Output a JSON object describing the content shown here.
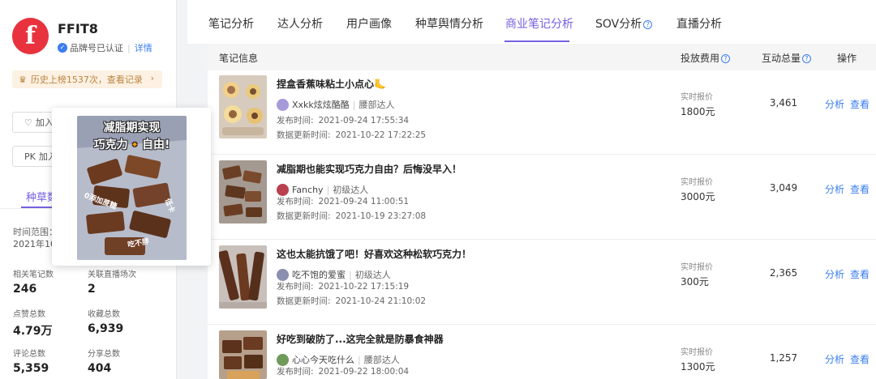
{
  "brand": {
    "logo_letter": "f",
    "name": "FFIT8",
    "verified_text": "品牌号已认证",
    "detail_link": "详情",
    "history_text": "历史上榜1537次，查看记录",
    "btn_add1": "加入",
    "btn_pk": "PK",
    "btn_add2": "加入",
    "side_tab": "种草数",
    "time_label": "时间范围：",
    "time_value": "2021年10月"
  },
  "stats": [
    {
      "label": "相关笔记数",
      "value": "246"
    },
    {
      "label": "关联直播场次",
      "value": "2"
    },
    {
      "label": "点赞总数",
      "value": "4.79万"
    },
    {
      "label": "收藏总数",
      "value": "6,939"
    },
    {
      "label": "评论总数",
      "value": "5,359"
    },
    {
      "label": "分享总数",
      "value": "404"
    }
  ],
  "tabs": [
    "笔记分析",
    "达人分析",
    "用户画像",
    "种草舆情分析",
    "商业笔记分析",
    "SOV分析",
    "直播分析"
  ],
  "active_tab": "商业笔记分析",
  "table_headers": {
    "info": "笔记信息",
    "cost": "投放费用",
    "interact": "互动总量",
    "ops": "操作"
  },
  "rows": [
    {
      "title": "捏盒香蕉味粘土小点心🦶",
      "author": "Xxkk炫炫酪酪",
      "level": "腰部达人",
      "publish_label": "发布时间:",
      "publish": "2021-09-24 17:55:34",
      "update_label": "数据更新时间:",
      "update": "2021-10-22 17:22:25",
      "price_label": "实时报价",
      "price": "1800元",
      "interact": "3,461",
      "op1": "分析",
      "op2": "查看"
    },
    {
      "title": "减脂期也能实现巧克力自由？后悔没早入！",
      "author": "Fanchy",
      "level": "初级达人",
      "publish_label": "发布时间:",
      "publish": "2021-09-24 11:00:51",
      "update_label": "数据更新时间:",
      "update": "2021-10-19 23:27:08",
      "price_label": "实时报价",
      "price": "3000元",
      "interact": "3,049",
      "op1": "分析",
      "op2": "查看"
    },
    {
      "title": "这也太能抗饿了吧！好喜欢这种松软巧克力！",
      "author": "吃不饱的爱蜜",
      "level": "初级达人",
      "publish_label": "发布时间:",
      "publish": "2021-10-22 17:15:19",
      "update_label": "数据更新时间:",
      "update": "2021-10-24 21:10:02",
      "price_label": "实时报价",
      "price": "300元",
      "interact": "2,365",
      "op1": "分析",
      "op2": "查看"
    },
    {
      "title": "好吃到破防了...这完全就是防暴食神器",
      "author": "心心今天吃什么",
      "level": "腰部达人",
      "publish_label": "发布时间:",
      "publish": "2021-09-22 18:00:04",
      "price_label": "实时报价",
      "price": "1300元",
      "interact": "1,257",
      "op1": "分析",
      "op2": "查看"
    }
  ],
  "popup": {
    "caption_line1": "减脂期实现",
    "caption_line2": "巧克力🔸自由!",
    "sticker1": "0添加蔗糖",
    "sticker2": "低卡",
    "sticker3": "吃不胖"
  },
  "colors": {
    "accent": "#7560e0",
    "link": "#3b7df0",
    "brand_red": "#e8333f"
  }
}
